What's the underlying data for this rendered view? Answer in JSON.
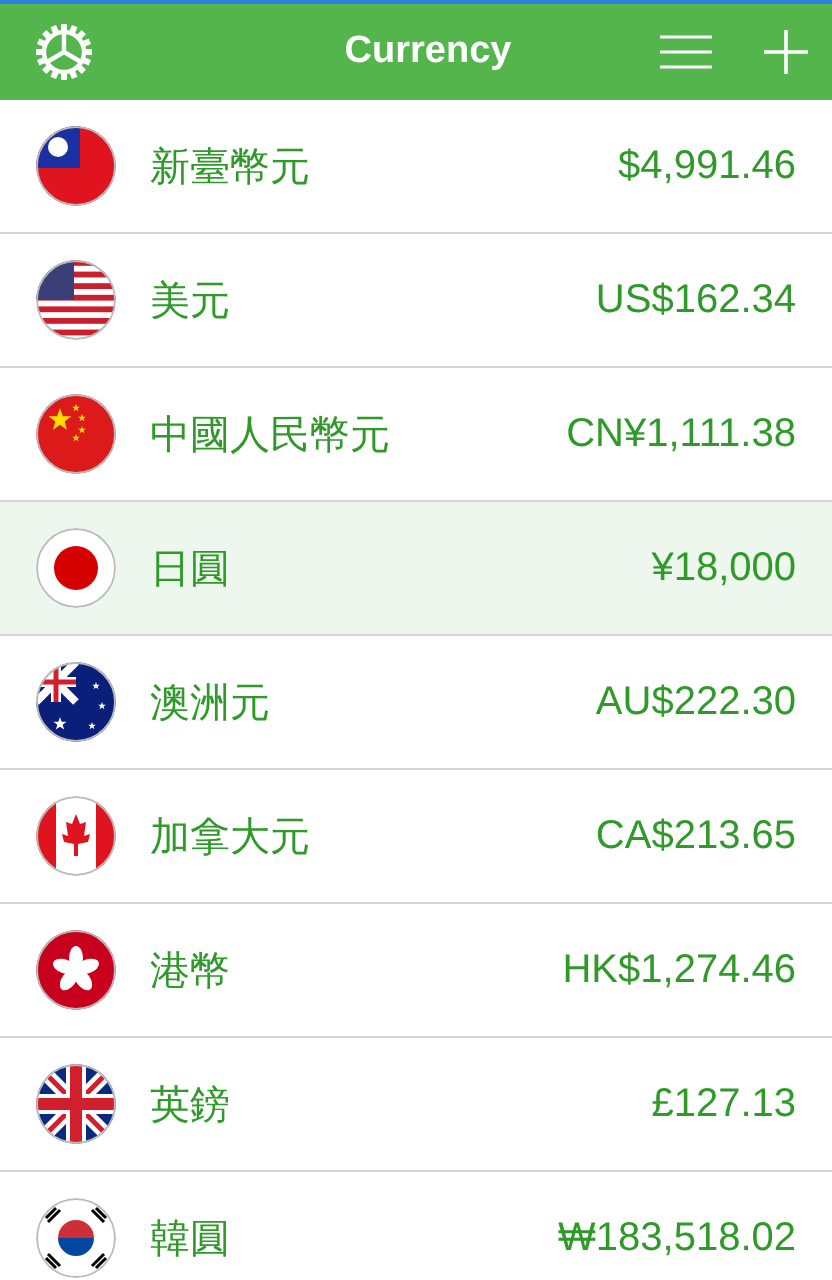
{
  "header": {
    "title": "Currency"
  },
  "currencies": [
    {
      "name": "新臺幣元",
      "amount": "$4,991.46",
      "selected": false
    },
    {
      "name": "美元",
      "amount": "US$162.34",
      "selected": false
    },
    {
      "name": "中國人民幣元",
      "amount": "CN¥1,111.38",
      "selected": false
    },
    {
      "name": "日圓",
      "amount": "¥18,000",
      "selected": true
    },
    {
      "name": "澳洲元",
      "amount": "AU$222.30",
      "selected": false
    },
    {
      "name": "加拿大元",
      "amount": "CA$213.65",
      "selected": false
    },
    {
      "name": "港幣",
      "amount": "HK$1,274.46",
      "selected": false
    },
    {
      "name": "英鎊",
      "amount": "£127.13",
      "selected": false
    },
    {
      "name": "韓圓",
      "amount": "₩183,518.02",
      "selected": false
    }
  ]
}
